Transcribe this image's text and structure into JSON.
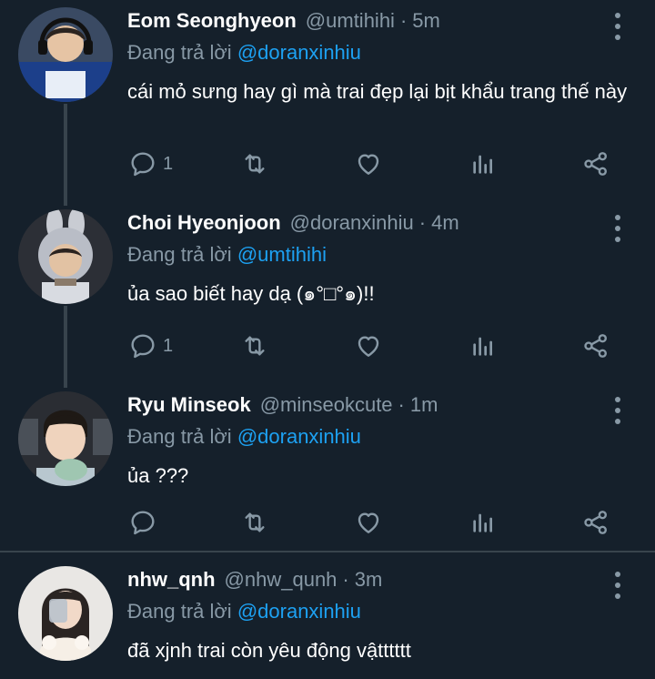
{
  "tweets": [
    {
      "name": "Eom Seonghyeon",
      "handle": "@umtihihi",
      "separator": "·",
      "time": "5m",
      "replying_prefix": "Đang trả lời",
      "replying_to": "@doranxinhiu",
      "text": "cái mỏ sưng hay gì mà trai đẹp lại bịt khẩu trang thế này",
      "reply_count": "1"
    },
    {
      "name": "Choi Hyeonjoon",
      "handle": "@doranxinhiu",
      "separator": "·",
      "time": "4m",
      "replying_prefix": "Đang trả lời",
      "replying_to": "@umtihihi",
      "text": "ủa sao biết hay dạ (๑°□°๑)!!",
      "reply_count": "1"
    },
    {
      "name": "Ryu Minseok",
      "handle": "@minseokcute",
      "separator": "·",
      "time": "1m",
      "replying_prefix": "Đang trả lời",
      "replying_to": "@doranxinhiu",
      "text": "ủa ???",
      "reply_count": ""
    },
    {
      "name": "nhw_qnh",
      "handle": "@nhw_qunh",
      "separator": "·",
      "time": "3m",
      "replying_prefix": "Đang trả lời",
      "replying_to": "@doranxinhiu",
      "text": "đã xjnh trai còn yêu động vậtttttt",
      "reply_count": ""
    }
  ],
  "icons": {
    "reply": "reply-icon",
    "retweet": "retweet-icon",
    "like": "heart-icon",
    "analytics": "analytics-icon",
    "share": "share-icon",
    "more": "more-vertical-icon"
  },
  "colors": {
    "background": "#15202b",
    "text": "#ffffff",
    "muted": "#8899a6",
    "accent": "#1da1f2",
    "divider": "#38444d"
  }
}
